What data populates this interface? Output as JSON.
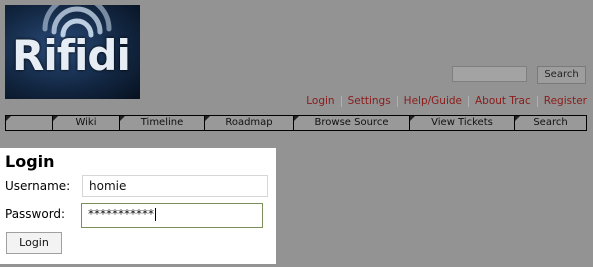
{
  "logo": {
    "text": "Rifidi",
    "icon": "wifi-waves-icon"
  },
  "search": {
    "value": "",
    "button_label": "Search"
  },
  "metanav": [
    "Login",
    "Settings",
    "Help/Guide",
    "About Trac",
    "Register"
  ],
  "mainnav": [
    "",
    "Wiki",
    "Timeline",
    "Roadmap",
    "Browse Source",
    "View Tickets",
    "Search"
  ],
  "login": {
    "title": "Login",
    "username_label": "Username:",
    "username_value": "homie",
    "password_label": "Password:",
    "password_value": "***********",
    "button_label": "Login"
  },
  "colors": {
    "background": "#939393",
    "link": "#8b1a1a",
    "panel": "#ffffff"
  }
}
